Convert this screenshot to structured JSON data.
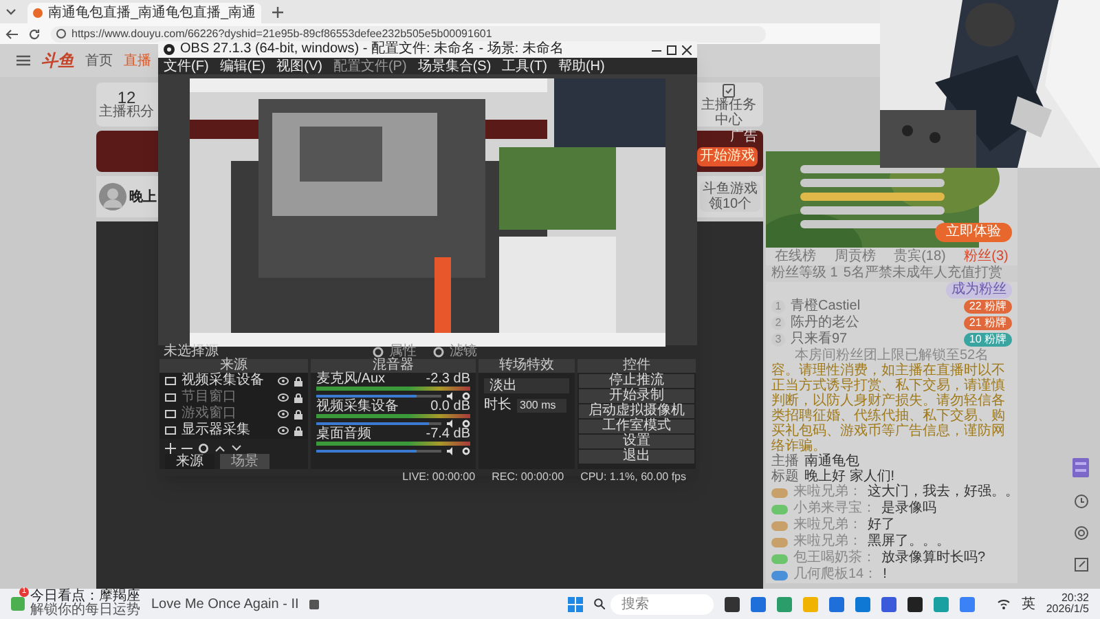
{
  "browser": {
    "tab_title": "南通龟包直播_南通龟包直播_南通",
    "url": "https://www.douyu.com/66226?dyshid=21e95b-89cf86553defee232b505e5b00091601"
  },
  "site": {
    "logo": "斗鱼",
    "nav": [
      {
        "label": "首页",
        "selected": false
      },
      {
        "label": "直播",
        "selected": true
      }
    ],
    "score": {
      "value": "12",
      "label": "主播积分"
    },
    "task_center": "主播任务中心",
    "banner": {
      "tag": "广告",
      "button": "开始游戏"
    },
    "greeting": "晚上",
    "game_gift": {
      "title": "斗鱼游戏",
      "reward": "领10个"
    },
    "promo_button": "立即体验",
    "rank_tabs": [
      {
        "label": "在线榜",
        "selected": false
      },
      {
        "label": "周贡榜",
        "selected": false
      },
      {
        "label": "贵宾(18)",
        "selected": false
      },
      {
        "label": "粉丝(3)",
        "selected": true
      }
    ],
    "fan_header": {
      "level": "粉丝等级 1",
      "notice": "5名严禁未成年人充值打赏",
      "join": "成为粉丝"
    },
    "fans": [
      {
        "rank": "1",
        "name": "青橙Castiel",
        "badge": "22 粉牌",
        "color": "#e0683a"
      },
      {
        "rank": "2",
        "name": "陈丹的老公",
        "badge": "21 粉牌",
        "color": "#e0683a"
      },
      {
        "rank": "3",
        "name": "只来看97",
        "badge": "10 粉牌",
        "color": "#3aa5a0"
      }
    ],
    "fan_limit": "本房间粉丝团上限已解锁至52名",
    "notice": "容。请理性消费，如主播在直播时以不正当方式诱导打赏、私下交易，请谨慎判断，以防人身财产损失。请勿轻信各类招聘征婚、代练代抽、私下交易、购买礼包码、游戏币等广告信息，谨防网络诈骗。",
    "room_info": [
      {
        "label": "主播",
        "value": "南通龟包"
      },
      {
        "label": "标题",
        "value": "晚上好 家人们!"
      }
    ],
    "chat": [
      {
        "user": "来啦兄弟：",
        "text": "这大门，我去，好强。。",
        "color": "#c8a06a"
      },
      {
        "user": "小弟来寻宝：",
        "text": "是录像吗",
        "color": "#6cc46c"
      },
      {
        "user": "来啦兄弟：",
        "text": "好了",
        "color": "#c8a06a"
      },
      {
        "user": "来啦兄弟：",
        "text": "黑屏了。。。",
        "color": "#c8a06a"
      },
      {
        "user": "包王喝奶茶：",
        "text": "放录像算时长吗?",
        "color": "#6cc46c"
      },
      {
        "user": "几何爬板14：",
        "text": "!",
        "color": "#4a90d9"
      }
    ]
  },
  "obs": {
    "title": "OBS 27.1.3 (64-bit, windows) - 配置文件: 未命名 - 场景: 未命名",
    "menu": [
      {
        "label": "文件(F)",
        "disabled": false
      },
      {
        "label": "编辑(E)",
        "disabled": false
      },
      {
        "label": "视图(V)",
        "disabled": false
      },
      {
        "label": "配置文件(P)",
        "disabled": true
      },
      {
        "label": "场景集合(S)",
        "disabled": false
      },
      {
        "label": "工具(T)",
        "disabled": false
      },
      {
        "label": "帮助(H)",
        "disabled": false
      }
    ],
    "source_bar": {
      "label": "未选择源",
      "buttons": [
        "属性",
        "滤镜"
      ]
    },
    "sources": {
      "title": "来源",
      "items": [
        {
          "name": "视频采集设备",
          "disabled": false
        },
        {
          "name": "节目窗口",
          "disabled": true
        },
        {
          "name": "游戏窗口",
          "disabled": true
        },
        {
          "name": "显示器采集",
          "disabled": false
        }
      ],
      "tabs": [
        {
          "label": "来源",
          "selected": true
        },
        {
          "label": "场景",
          "selected": false
        }
      ]
    },
    "mixer": {
      "title": "混音器",
      "channels": [
        {
          "name": "麦克风/Aux",
          "reading": "-2.3 dB",
          "level": 0.8
        },
        {
          "name": "视频采集设备",
          "reading": "0.0 dB",
          "level": 0.9
        },
        {
          "name": "桌面音频",
          "reading": "-7.4 dB",
          "level": 0.8
        }
      ]
    },
    "transitions": {
      "title": "转场特效",
      "value": "淡出",
      "duration_label": "时长",
      "duration": "300 ms"
    },
    "controls": {
      "title": "控件",
      "buttons": [
        "停止推流",
        "开始录制",
        "启动虚拟摄像机",
        "工作室模式",
        "设置",
        "退出"
      ]
    },
    "status": {
      "live": "LIVE: 00:00:00",
      "rec": "REC: 00:00:00",
      "cpu": "CPU: 1.1%, 60.00 fps"
    }
  },
  "taskbar": {
    "news_title": "今日看点：摩羯座",
    "news_subtitle": "解锁你的每日运势",
    "news_badge": "1",
    "media": "Love Me Once Again - II",
    "search": {
      "placeholder": "搜索"
    },
    "ime": "英",
    "time": "20:32",
    "date": "2026/1/5"
  }
}
